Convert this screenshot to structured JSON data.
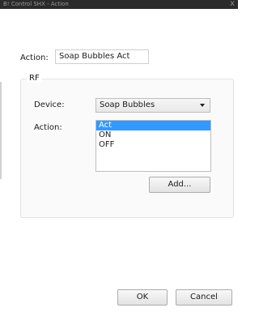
{
  "window": {
    "title": "B! Control SHX - Action",
    "close_glyph": "x"
  },
  "action_name": {
    "label": "Action:",
    "value": "Soap Bubbles Act"
  },
  "rf": {
    "group_title": "RF",
    "device_label": "Device:",
    "device_value": "Soap Bubbles",
    "action_label": "Action:",
    "action_options": [
      "Act",
      "ON",
      "OFF"
    ],
    "selected_action": "Act",
    "add_button": "Add..."
  },
  "footer": {
    "ok": "OK",
    "cancel": "Cancel"
  }
}
